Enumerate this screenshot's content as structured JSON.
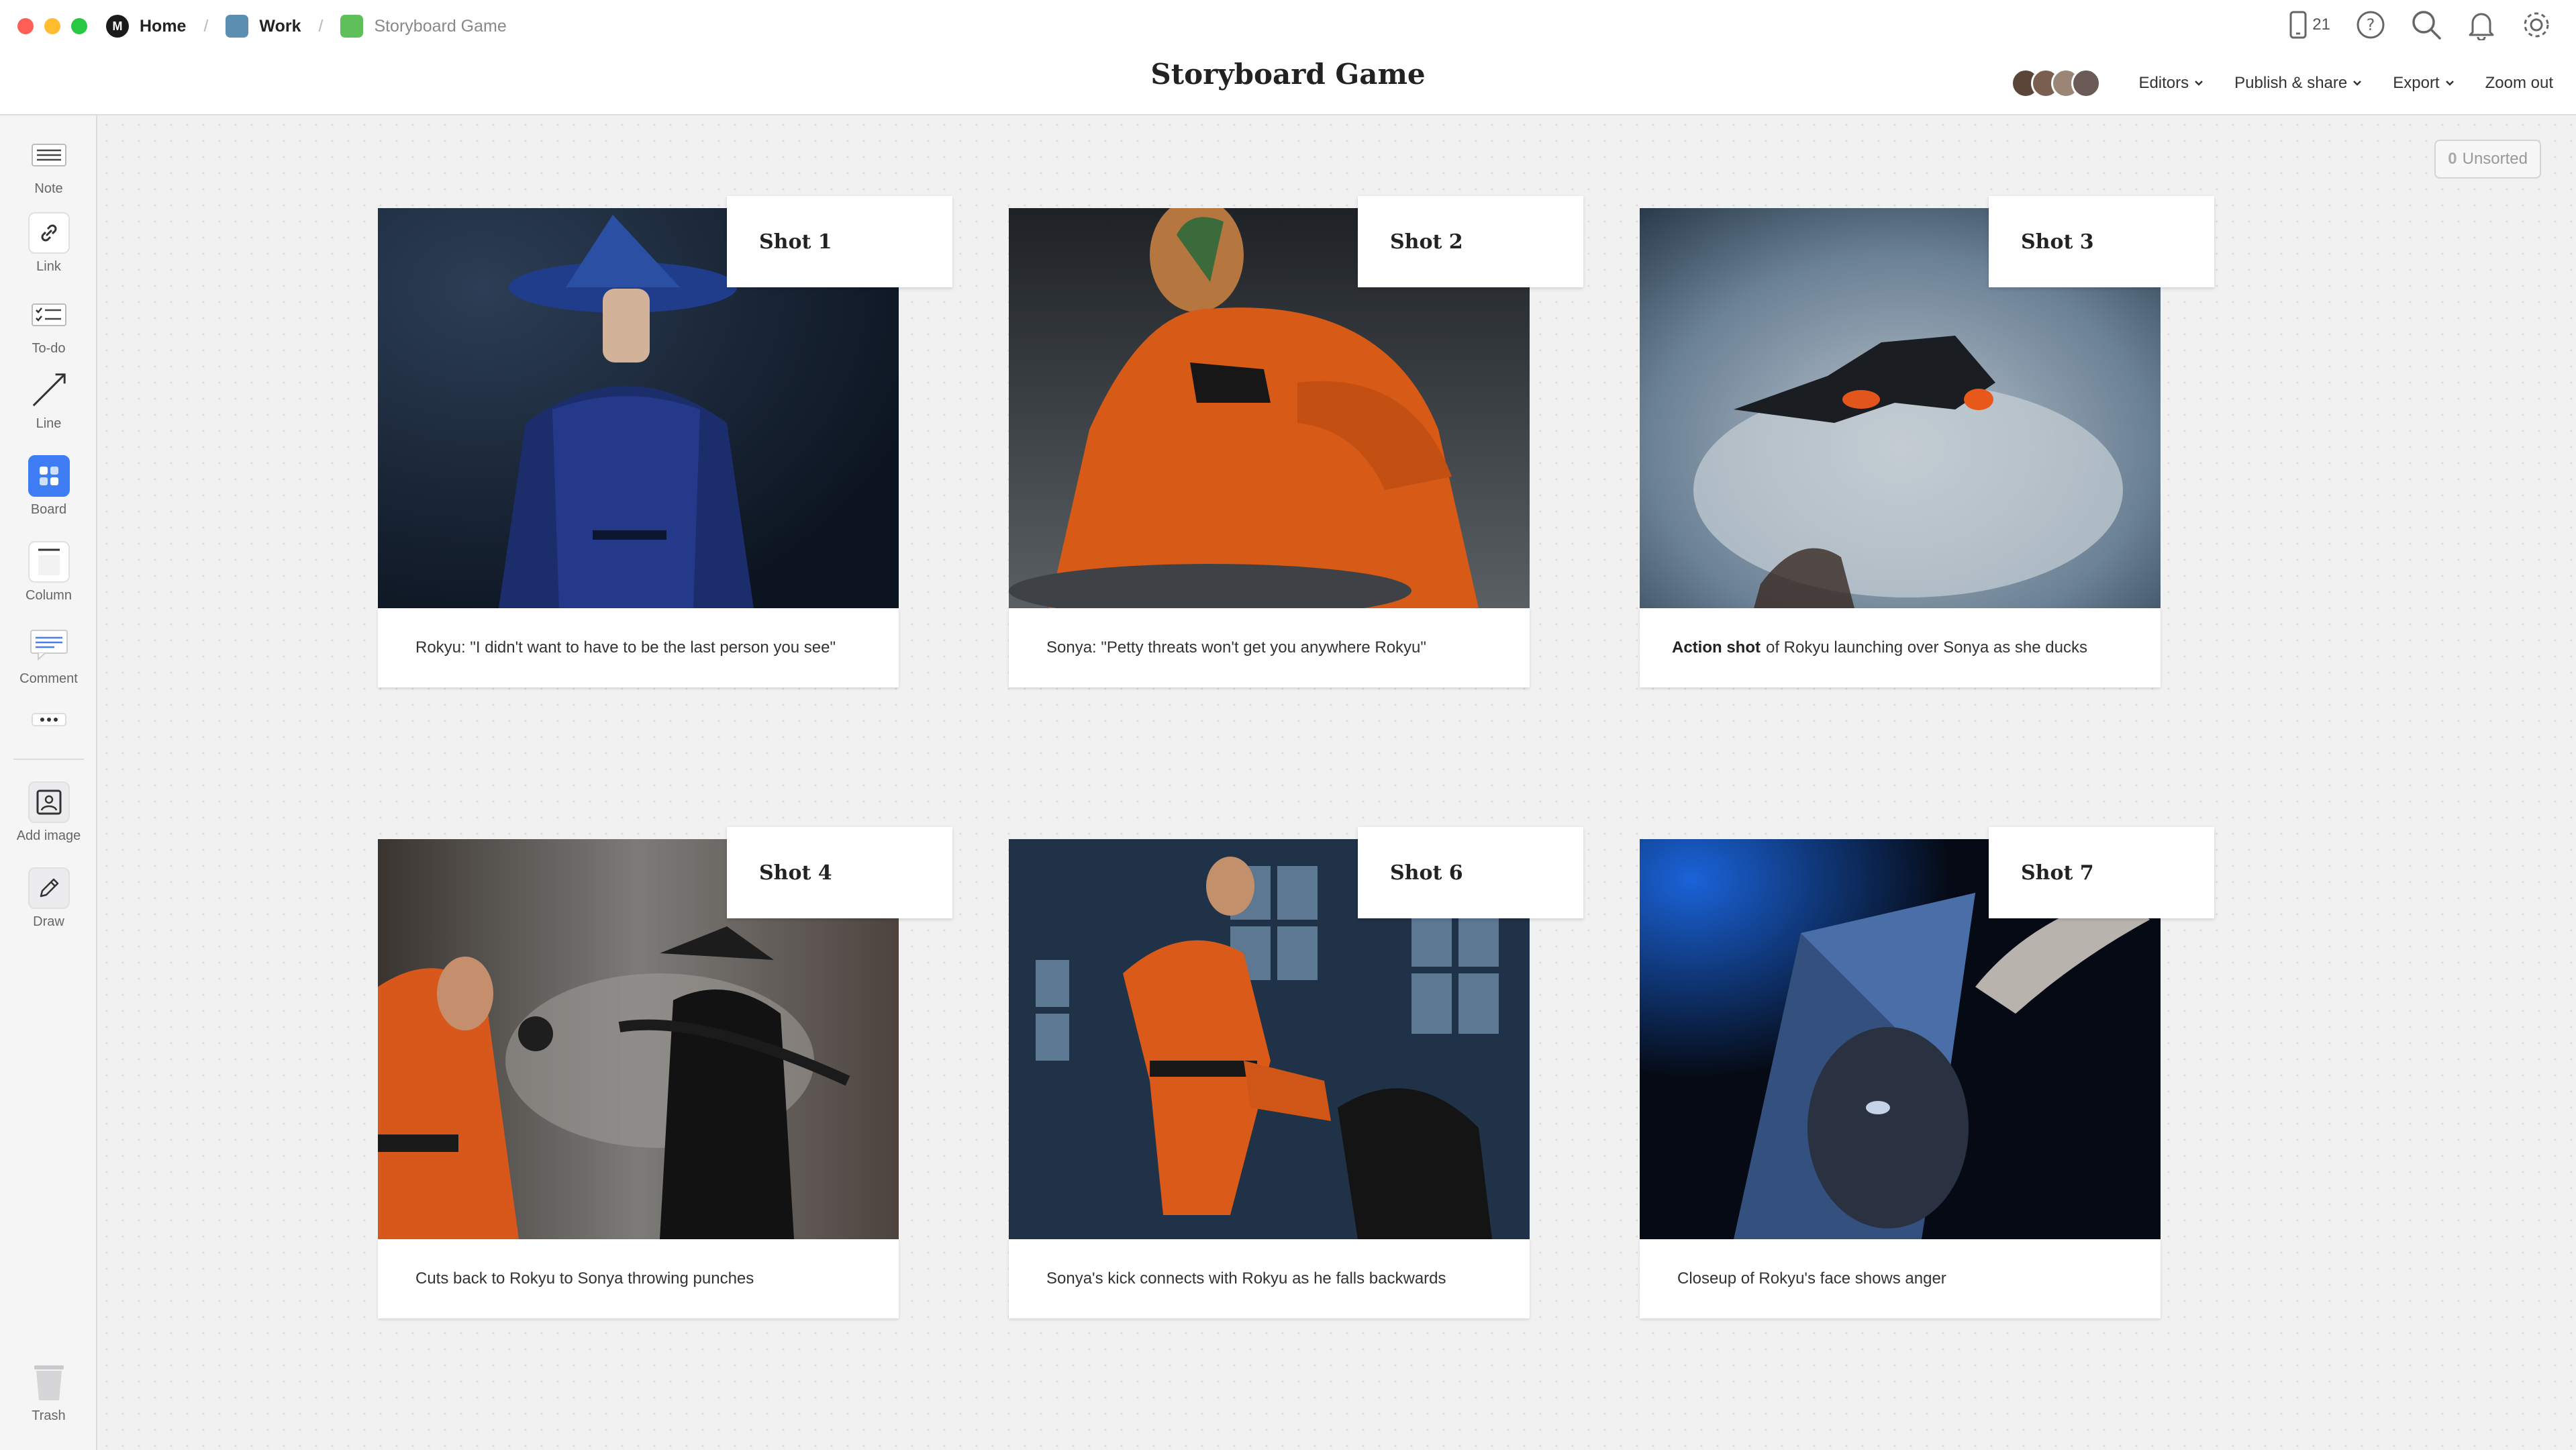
{
  "breadcrumbs": [
    {
      "label": "Home"
    },
    {
      "label": "Work"
    },
    {
      "label": "Storyboard Game"
    }
  ],
  "title": "Storyboard Game",
  "top_icons": {
    "device_count": "21"
  },
  "menus": {
    "editors": "Editors",
    "publish": "Publish & share",
    "export": "Export",
    "zoom": "Zoom out"
  },
  "sidebar": {
    "note": "Note",
    "link": "Link",
    "todo": "To-do",
    "line": "Line",
    "board": "Board",
    "column": "Column",
    "comment": "Comment",
    "add_image": "Add image",
    "draw": "Draw",
    "trash": "Trash"
  },
  "unsorted": {
    "count": "0",
    "label": "Unsorted"
  },
  "cards": [
    {
      "label": "Shot 1",
      "bold": "",
      "caption": "Rokyu: \"I didn't want to have to be the last person you see\""
    },
    {
      "label": "Shot 2",
      "bold": "",
      "caption": "Sonya: \"Petty threats won't get you anywhere Rokyu\""
    },
    {
      "label": "Shot 3",
      "bold": "Action shot",
      "caption": "of Rokyu launching over Sonya as she ducks"
    },
    {
      "label": "Shot 4",
      "bold": "",
      "caption": "Cuts back to Rokyu to Sonya throwing punches"
    },
    {
      "label": "Shot 6",
      "bold": "",
      "caption": "Sonya's kick connects with Rokyu as he falls backwards"
    },
    {
      "label": "Shot 7",
      "bold": "",
      "caption": "Closeup of Rokyu's face shows anger"
    }
  ],
  "colors": {
    "accent": "#3e7df4",
    "canvas": "#f1f1f2"
  }
}
